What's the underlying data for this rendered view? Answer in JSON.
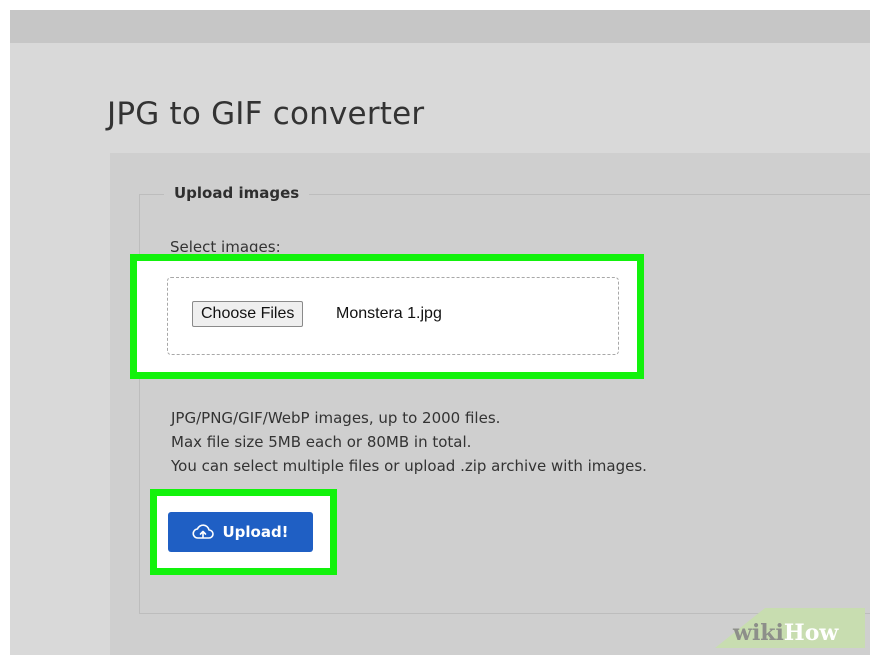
{
  "page": {
    "title": "JPG to GIF converter"
  },
  "upload_form": {
    "legend": "Upload images",
    "select_label": "Select images:",
    "choose_button_label": "Choose Files",
    "selected_file": "Monstera 1.jpg",
    "help_lines": [
      "JPG/PNG/GIF/WebP images, up to 2000 files.",
      "Max file size 5MB each or 80MB in total.",
      "You can select multiple files or upload .zip archive with images."
    ],
    "upload_button_label": "Upload!",
    "upload_icon": "cloud-upload-icon"
  },
  "watermark": {
    "wiki": "wiki",
    "how": "How"
  },
  "colors": {
    "highlight": "#12f20c",
    "upload_button": "#1f5fc4",
    "background": "#d9d9d9",
    "panel": "#cfcfcf"
  }
}
